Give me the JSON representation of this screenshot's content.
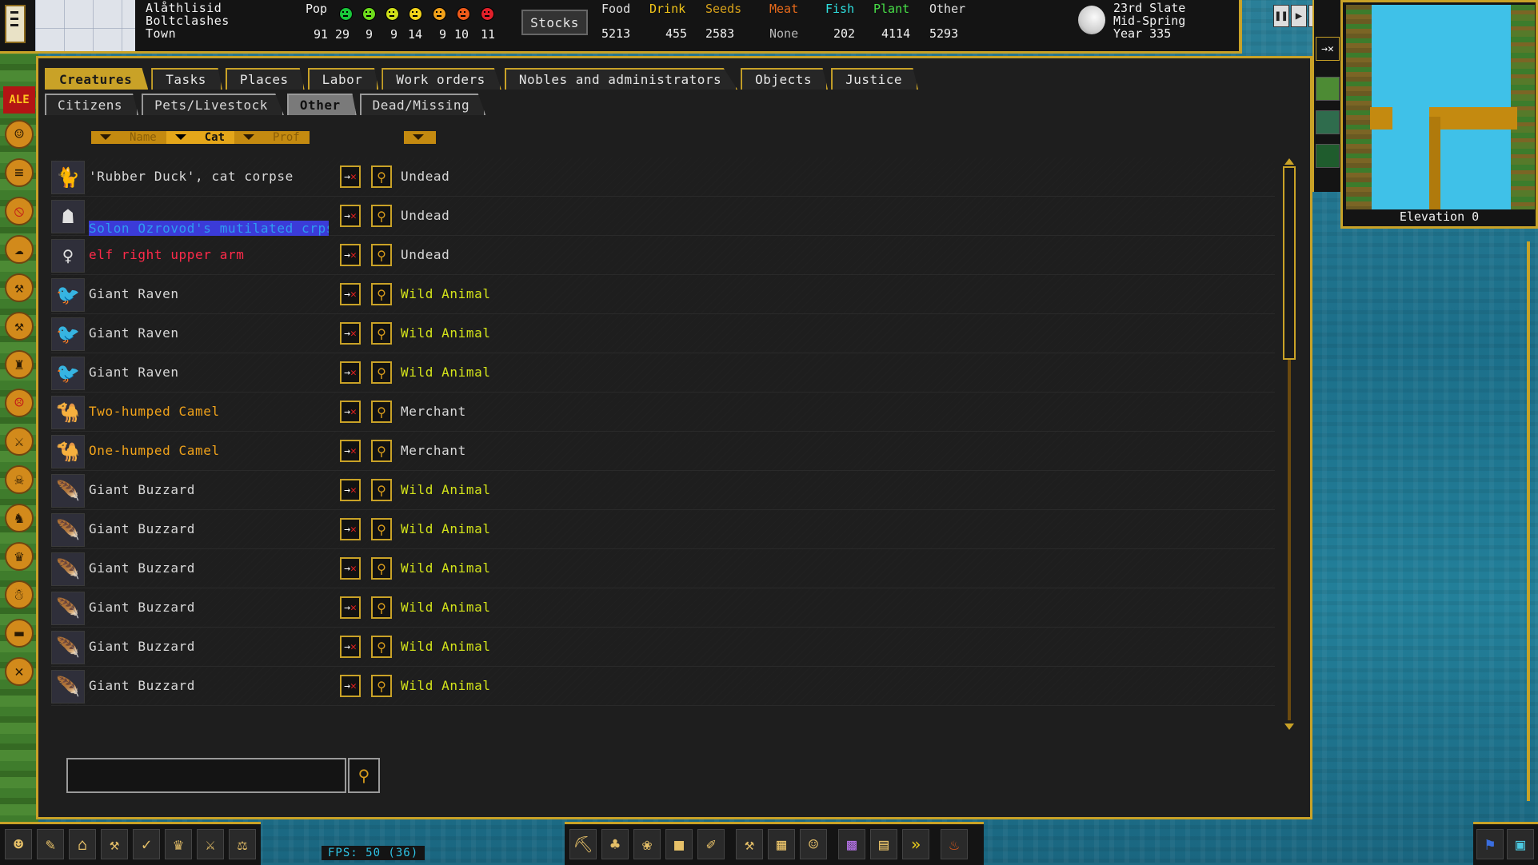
{
  "top": {
    "fort_line1": "Alåthlisid",
    "fort_line2": "Boltclashes",
    "fort_line3": "Town",
    "pop_label": "Pop",
    "pop_counts": [
      "91",
      "29",
      "9",
      "9",
      "14",
      "9",
      "10",
      "11"
    ],
    "stocks_label": "Stocks",
    "resources": [
      {
        "label": "Food",
        "value": "5213",
        "color": "#f2f2f2"
      },
      {
        "label": "Drink",
        "value": "455",
        "color": "#f0c419"
      },
      {
        "label": "Seeds",
        "value": "2583",
        "color": "#d8a21a"
      },
      {
        "label": "Meat",
        "value": "None",
        "color": "#e86a1a"
      },
      {
        "label": "Fish",
        "value": "202",
        "color": "#2ee0e0"
      },
      {
        "label": "Plant",
        "value": "4114",
        "color": "#48e048"
      },
      {
        "label": "Other",
        "value": "5293",
        "color": "#f2f2f2"
      }
    ],
    "date_line1": "23rd Slate",
    "date_line2": "Mid-Spring",
    "date_line3": "Year 335",
    "controls": [
      "pause-icon",
      "play-icon",
      "settings-icon",
      "help-icon"
    ]
  },
  "minimap": {
    "elevation": "Elevation 0"
  },
  "sidebar": {
    "alert_label": "ALE",
    "icons": [
      "citizen-face-icon",
      "scroll-icon",
      "no-entry-icon",
      "weather-icon",
      "pickaxe-icon",
      "hammer-icon",
      "squad-icon",
      "angry-face-icon",
      "sword-icon",
      "skull-icon",
      "horse-icon",
      "crown-icon",
      "ghost-icon",
      "anvil-icon",
      "crossed-tools-icon"
    ]
  },
  "tabs": [
    {
      "label": "Creatures",
      "active": true
    },
    {
      "label": "Tasks",
      "active": false
    },
    {
      "label": "Places",
      "active": false
    },
    {
      "label": "Labor",
      "active": false
    },
    {
      "label": "Work orders",
      "active": false
    },
    {
      "label": "Nobles and administrators",
      "active": false
    },
    {
      "label": "Objects",
      "active": false
    },
    {
      "label": "Justice",
      "active": false
    }
  ],
  "subtabs": [
    {
      "label": "Citizens",
      "active": false
    },
    {
      "label": "Pets/Livestock",
      "active": false
    },
    {
      "label": "Other",
      "active": true
    },
    {
      "label": "Dead/Missing",
      "active": false
    }
  ],
  "sort": {
    "name": "Name",
    "cat": "Cat",
    "prof": "Prof"
  },
  "creatures": [
    {
      "name": "'Rubber Duck', cat corpse",
      "name_color": "#d8d8d8",
      "category": "Undead",
      "cat_color": "#d8d8d8",
      "portrait": "cat-icon",
      "selected": false
    },
    {
      "name": "Solon Ozrovod's mutilated crps",
      "name_color": "#2f9cf0",
      "category": "Undead",
      "cat_color": "#d8d8d8",
      "portrait": "dwarf-corpse-icon",
      "selected": true
    },
    {
      "name": "elf right upper arm",
      "name_color": "#ff2a4a",
      "category": "Undead",
      "cat_color": "#d8d8d8",
      "portrait": "elf-icon",
      "selected": false
    },
    {
      "name": "Giant Raven",
      "name_color": "#d8d8d8",
      "category": "Wild Animal",
      "cat_color": "#d4e41a",
      "portrait": "raven-icon",
      "selected": false
    },
    {
      "name": "Giant Raven",
      "name_color": "#d8d8d8",
      "category": "Wild Animal",
      "cat_color": "#d4e41a",
      "portrait": "raven-icon",
      "selected": false
    },
    {
      "name": "Giant Raven",
      "name_color": "#d8d8d8",
      "category": "Wild Animal",
      "cat_color": "#d4e41a",
      "portrait": "raven-icon",
      "selected": false
    },
    {
      "name": "Two-humped Camel",
      "name_color": "#f0a21a",
      "category": "Merchant",
      "cat_color": "#d8d8d8",
      "portrait": "camel-icon",
      "selected": false
    },
    {
      "name": "One-humped Camel",
      "name_color": "#f0a21a",
      "category": "Merchant",
      "cat_color": "#d8d8d8",
      "portrait": "camel-icon",
      "selected": false
    },
    {
      "name": "Giant Buzzard",
      "name_color": "#d8d8d8",
      "category": "Wild Animal",
      "cat_color": "#d4e41a",
      "portrait": "buzzard-icon",
      "selected": false
    },
    {
      "name": "Giant Buzzard",
      "name_color": "#d8d8d8",
      "category": "Wild Animal",
      "cat_color": "#d4e41a",
      "portrait": "buzzard-icon",
      "selected": false
    },
    {
      "name": "Giant Buzzard",
      "name_color": "#d8d8d8",
      "category": "Wild Animal",
      "cat_color": "#d4e41a",
      "portrait": "buzzard-icon",
      "selected": false
    },
    {
      "name": "Giant Buzzard",
      "name_color": "#d8d8d8",
      "category": "Wild Animal",
      "cat_color": "#d4e41a",
      "portrait": "buzzard-icon",
      "selected": false
    },
    {
      "name": "Giant Buzzard",
      "name_color": "#d8d8d8",
      "category": "Wild Animal",
      "cat_color": "#d4e41a",
      "portrait": "buzzard-icon",
      "selected": false
    },
    {
      "name": "Giant Buzzard",
      "name_color": "#d8d8d8",
      "category": "Wild Animal",
      "cat_color": "#d4e41a",
      "portrait": "buzzard-icon",
      "selected": false
    }
  ],
  "search": {
    "value": ""
  },
  "fps": "FPS: 50 (36)",
  "colors": {
    "accent_gold": "#c9a227",
    "panel_bg": "#1e1e1e",
    "selection_bg": "#3b3bd8"
  }
}
